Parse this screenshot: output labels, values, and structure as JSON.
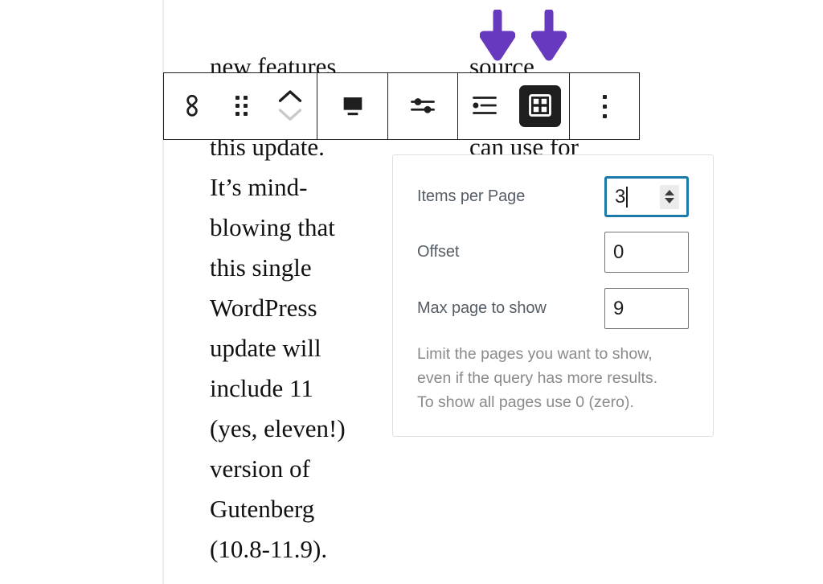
{
  "editor": {
    "article_text_left": "new features\n\nthis update.\nIt’s mind-\nblowing that\nthis single\nWordPress\nupdate will\ninclude 11\n(yes, eleven!)\nversion of\nGutenberg\n(10.8-11.9).",
    "article_text_right": "source\n\ncan use for"
  },
  "toolbar": {
    "buttons": [
      {
        "name": "query-loop-block-type",
        "icon": "query-loop-icon",
        "label": "Query Loop",
        "active": false
      },
      {
        "name": "drag-handle",
        "icon": "drag-handle-icon",
        "label": "Drag",
        "active": false
      },
      {
        "name": "move-block",
        "icon": "move-up-down-icon",
        "label": "Move up / Move down",
        "active": false
      },
      {
        "name": "display-settings",
        "icon": "post-content-icon",
        "label": "Display settings",
        "active": false
      },
      {
        "name": "block-settings",
        "icon": "sliders-icon",
        "label": "Settings",
        "active": false
      },
      {
        "name": "list-view",
        "icon": "list-view-icon",
        "label": "List view",
        "active": false
      },
      {
        "name": "grid-view",
        "icon": "grid-view-icon",
        "label": "Grid view",
        "active": true
      },
      {
        "name": "more-options",
        "icon": "vertical-ellipsis-icon",
        "label": "Options",
        "active": false
      }
    ]
  },
  "annotations": {
    "arrow_color": "#6639BF",
    "arrows": [
      {
        "name": "arrow-pointing-list-view"
      },
      {
        "name": "arrow-pointing-grid-view"
      }
    ]
  },
  "settings_popover": {
    "fields": [
      {
        "label": "Items per Page",
        "value": "3",
        "focused": true,
        "has_spinner": true
      },
      {
        "label": "Offset",
        "value": "0",
        "focused": false,
        "has_spinner": false
      },
      {
        "label": "Max page to show",
        "value": "9",
        "focused": false,
        "has_spinner": false
      }
    ],
    "help_text": "Limit the pages you want to show,\neven if the query has more results.\nTo show all pages use 0 (zero).",
    "focus_border_color": "#1b7aa8"
  }
}
